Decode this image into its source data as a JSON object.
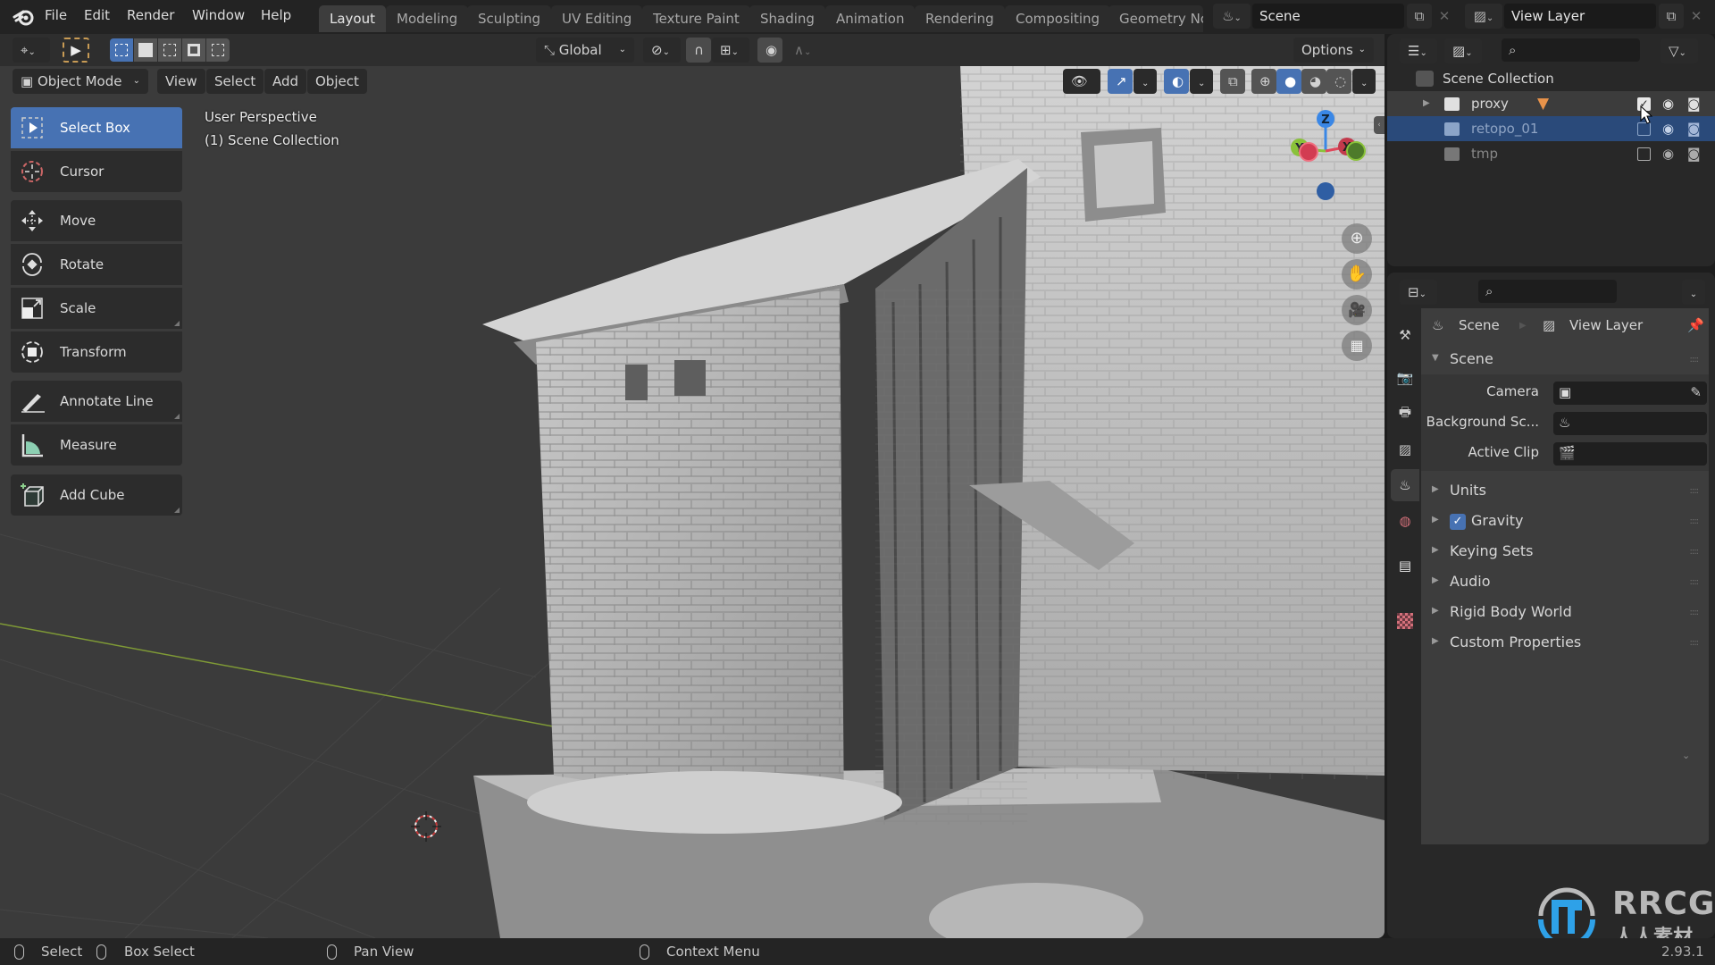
{
  "topbar": {
    "menus": [
      "File",
      "Edit",
      "Render",
      "Window",
      "Help"
    ],
    "workspaces": [
      "Layout",
      "Modeling",
      "Sculpting",
      "UV Editing",
      "Texture Paint",
      "Shading",
      "Animation",
      "Rendering",
      "Compositing",
      "Geometry Nc"
    ],
    "active_workspace": "Layout",
    "scene": "Scene",
    "view_layer": "View Layer"
  },
  "viewport": {
    "header": {
      "transform_orientation": "Global",
      "options_label": "Options",
      "mode": "Object Mode",
      "menus": [
        "View",
        "Select",
        "Add",
        "Object"
      ]
    },
    "overlay_text": {
      "line1": "User Perspective",
      "line2": "(1) Scene Collection"
    },
    "gizmo": {
      "z": "Z",
      "y": "Y",
      "x": "X"
    },
    "colors": {
      "x_axis": "#e0475b",
      "y_axis": "#8ac23a",
      "z_axis": "#3a87e6",
      "accent": "#4772b3"
    }
  },
  "toolbar": {
    "tools": [
      {
        "label": "Select Box",
        "icon": "select-box-icon",
        "active": true
      },
      {
        "label": "Cursor",
        "icon": "cursor-icon"
      },
      {
        "label": "Move",
        "icon": "move-icon"
      },
      {
        "label": "Rotate",
        "icon": "rotate-icon"
      },
      {
        "label": "Scale",
        "icon": "scale-icon"
      },
      {
        "label": "Transform",
        "icon": "transform-icon"
      },
      {
        "label": "Annotate Line",
        "icon": "annotate-icon"
      },
      {
        "label": "Measure",
        "icon": "measure-icon"
      },
      {
        "label": "Add Cube",
        "icon": "add-cube-icon"
      }
    ]
  },
  "outliner": {
    "root": "Scene Collection",
    "items": [
      {
        "name": "proxy",
        "checked": true,
        "expandable": true
      },
      {
        "name": "retopo_01",
        "checked": false,
        "selected": true
      },
      {
        "name": "tmp",
        "checked": false
      }
    ]
  },
  "properties": {
    "breadcrumb": [
      "Scene",
      "View Layer"
    ],
    "section": "Scene",
    "fields": [
      {
        "label": "Camera",
        "value": ""
      },
      {
        "label": "Background Sc...",
        "value": ""
      },
      {
        "label": "Active Clip",
        "value": ""
      }
    ],
    "panels": [
      "Units",
      "Gravity",
      "Keying Sets",
      "Audio",
      "Rigid Body World",
      "Custom Properties"
    ],
    "gravity_enabled": true
  },
  "statusbar": {
    "items": [
      "Select",
      "Box Select",
      "Pan View",
      "Context Menu"
    ],
    "version": "2.93.1"
  },
  "watermark": {
    "brand": "RRCG",
    "sub": "人人素材"
  }
}
